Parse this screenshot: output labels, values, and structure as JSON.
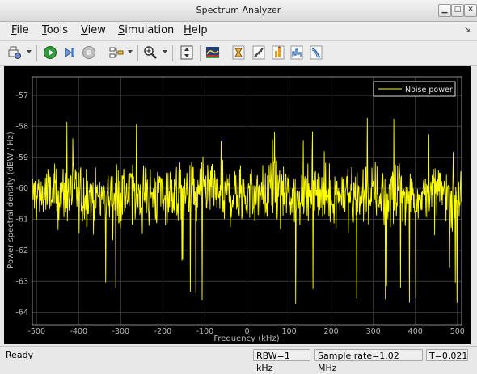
{
  "window": {
    "title": "Spectrum Analyzer"
  },
  "menu": [
    {
      "label": "File",
      "underline": "F",
      "rest": "ile"
    },
    {
      "label": "Tools",
      "underline": "T",
      "rest": "ools"
    },
    {
      "label": "View",
      "underline": "V",
      "rest": "iew"
    },
    {
      "label": "Simulation",
      "underline": "S",
      "rest": "imulation"
    },
    {
      "label": "Help",
      "underline": "H",
      "rest": "elp"
    }
  ],
  "status": {
    "ready": "Ready",
    "rbw": "RBW=1 kHz",
    "sample_rate": "Sample rate=1.02 MHz",
    "time": "T=0.021"
  },
  "colors": {
    "trace": "#ffff00",
    "background": "#000000",
    "grid": "#3a3a3a",
    "axis_text": "#b8b8b8"
  },
  "chart_data": {
    "type": "line",
    "xlabel": "Frequency (kHz)",
    "ylabel": "Power spectral density (dBW / Hz)",
    "xlim": [
      -510,
      510
    ],
    "ylim": [
      -64.4,
      -56.4
    ],
    "xticks": [
      -500,
      -400,
      -300,
      -200,
      -100,
      0,
      100,
      200,
      300,
      400,
      500
    ],
    "yticks": [
      -57,
      -58,
      -59,
      -60,
      -61,
      -62,
      -63,
      -64
    ],
    "grid": true,
    "legend": {
      "entries": [
        "Noise power"
      ],
      "placement": "top-right"
    },
    "series": [
      {
        "name": "Noise power",
        "x_range": [
          -510,
          510
        ],
        "points": 1020,
        "mean": -60.2,
        "spread": 0.9
      }
    ]
  }
}
